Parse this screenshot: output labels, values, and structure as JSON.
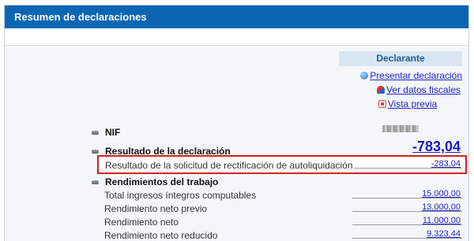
{
  "title": "Resumen de declaraciones",
  "declarant": {
    "header": "Declarante",
    "actions": [
      {
        "label": "Presentar declaración",
        "icon": "globe-icon"
      },
      {
        "label": "Ver datos fiscales",
        "icon": "fiscal-data-icon"
      },
      {
        "label": "Vista previa",
        "icon": "pdf-icon"
      }
    ]
  },
  "summary": {
    "nif_label": "NIF",
    "resultado_label": "Resultado de la declaración",
    "resultado_value": "-783,04",
    "rectificacion_label": "Resultado de la solicitud de rectificación de autoliquidación",
    "rectificacion_value": "-283,04",
    "rendimientos_label": "Rendimientos del trabajo"
  },
  "rendimientos": [
    {
      "label": "Total ingresos íntegros computables",
      "value": "15.000,00"
    },
    {
      "label": "Rendimiento neto previo",
      "value": "13.000,00"
    },
    {
      "label": "Rendimiento neto",
      "value": "11.000,00"
    },
    {
      "label": "Rendimiento neto reducido",
      "value": "9.323,44"
    }
  ],
  "colors": {
    "titlebar": "#0a66b3",
    "link": "#2222cc",
    "highlight_border": "#d42020",
    "panel_header_bg": "#d9e6f1"
  }
}
